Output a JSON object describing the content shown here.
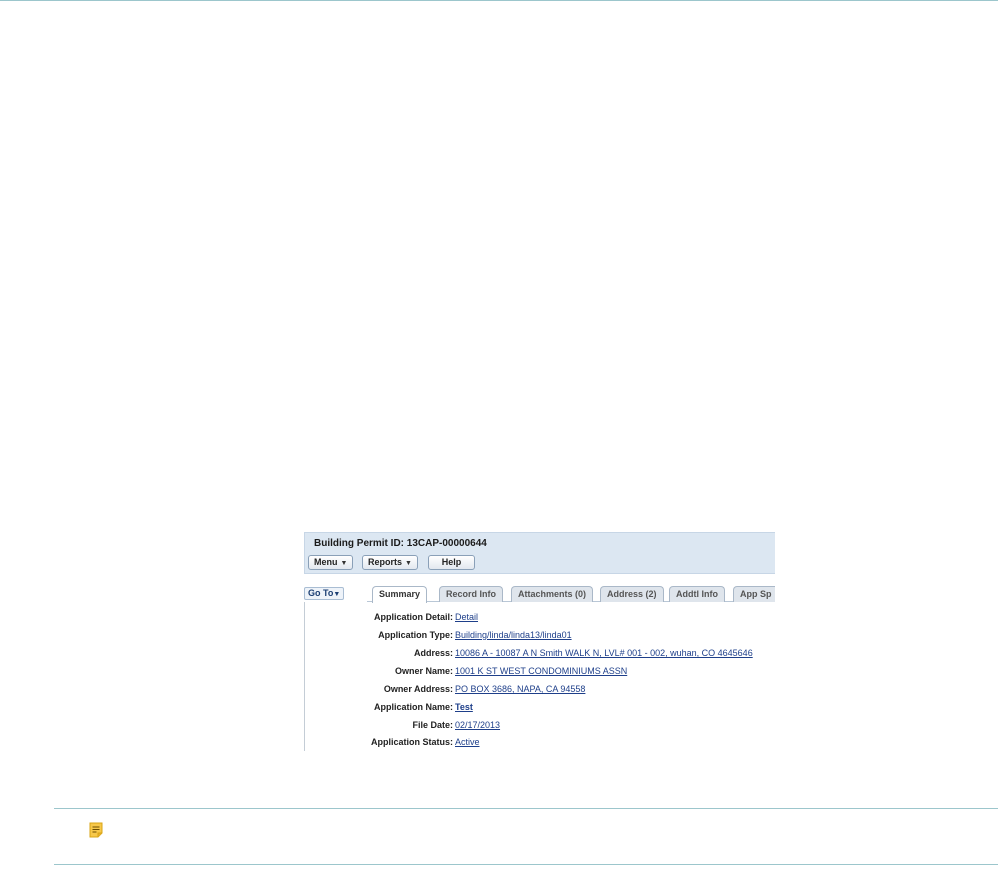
{
  "panel": {
    "title": "Building Permit ID: 13CAP-00000644",
    "toolbar": {
      "menu": "Menu",
      "reports": "Reports",
      "help": "Help"
    }
  },
  "goto": "Go To",
  "tabs": [
    "Summary",
    "Record Info",
    "Attachments (0)",
    "Address (2)",
    "Addtl Info",
    "App Sp"
  ],
  "summary": [
    {
      "label": "Application Detail:",
      "value": "Detail"
    },
    {
      "label": "Application Type:",
      "value": "Building/linda/linda13/linda01"
    },
    {
      "label": "Address:",
      "value": "10086 A - 10087 A N Smith WALK N, LVL# 001 - 002, wuhan, CO 4645646"
    },
    {
      "label": "Owner Name:",
      "value": "1001 K ST WEST CONDOMINIUMS ASSN"
    },
    {
      "label": "Owner Address:",
      "value": "PO BOX 3686, NAPA, CA 94558"
    },
    {
      "label": "Application Name:",
      "value": "Test"
    },
    {
      "label": "File Date:",
      "value": "02/17/2013"
    },
    {
      "label": "Application Status:",
      "value": "Active"
    }
  ],
  "icons": {
    "note": "note-icon",
    "dropdown": "chevron-down-icon"
  }
}
